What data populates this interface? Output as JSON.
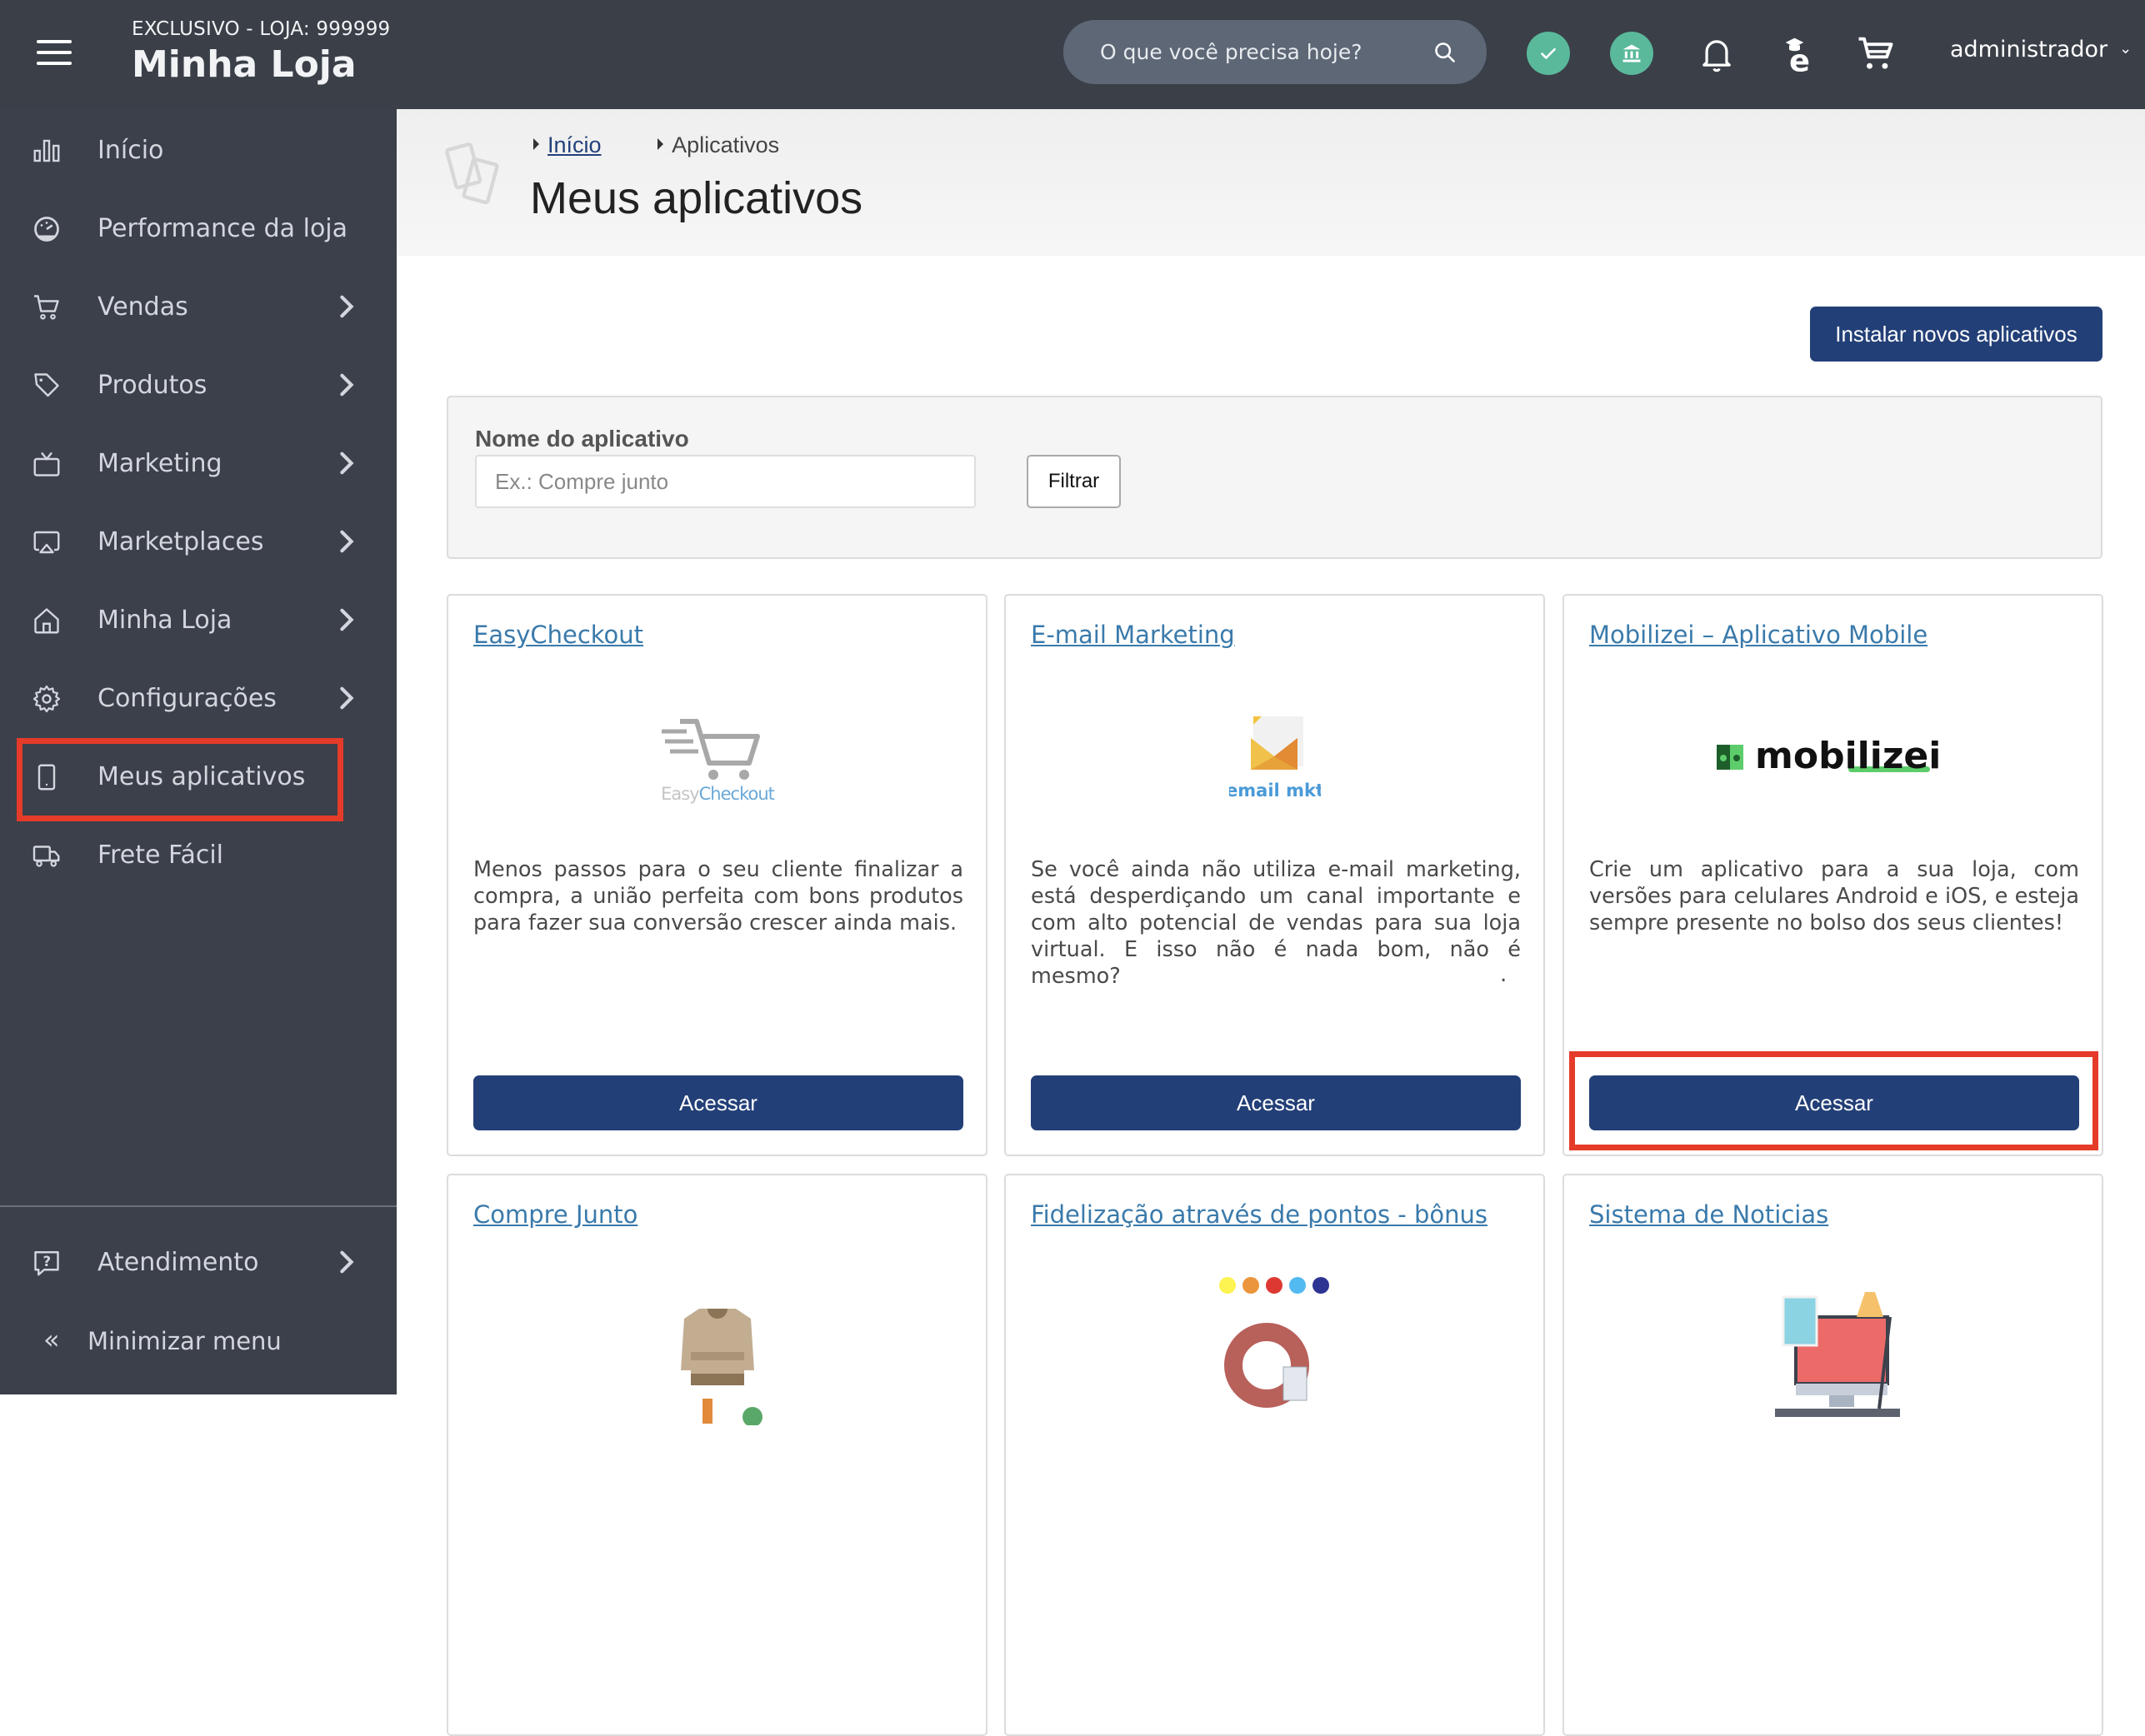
{
  "header": {
    "store_subtitle": "EXCLUSIVO - LOJA: 999999",
    "store_name": "Minha Loja",
    "search_placeholder": "O que você precisa hoje?",
    "icons": [
      "status-check-icon",
      "bank-icon",
      "bell-icon",
      "education-icon",
      "cart-icon"
    ],
    "user_label": "administrador",
    "accent_color": "#5ab99b"
  },
  "sidebar": {
    "items": [
      {
        "label": "Início",
        "icon": "bar-chart-icon",
        "has_submenu": false
      },
      {
        "label": "Performance da loja",
        "icon": "gauge-icon",
        "has_submenu": false
      },
      {
        "label": "Vendas",
        "icon": "cart-icon",
        "has_submenu": true
      },
      {
        "label": "Produtos",
        "icon": "tag-icon",
        "has_submenu": true
      },
      {
        "label": "Marketing",
        "icon": "tv-icon",
        "has_submenu": true
      },
      {
        "label": "Marketplaces",
        "icon": "airplay-icon",
        "has_submenu": true
      },
      {
        "label": "Minha Loja",
        "icon": "home-icon",
        "has_submenu": true
      },
      {
        "label": "Configurações",
        "icon": "gear-icon",
        "has_submenu": true
      },
      {
        "label": "Meus aplicativos",
        "icon": "phone-icon",
        "has_submenu": false,
        "highlighted": true
      },
      {
        "label": "Frete Fácil",
        "icon": "truck-icon",
        "has_submenu": false
      }
    ],
    "support": {
      "label": "Atendimento",
      "icon": "help-chat-icon",
      "has_submenu": true
    },
    "minimize_label": "Minimizar menu",
    "minimize_icon": "«"
  },
  "page": {
    "breadcrumb": [
      {
        "label": "Início",
        "link": true
      },
      {
        "label": "Aplicativos",
        "link": false
      }
    ],
    "title": "Meus aplicativos",
    "install_button": "Instalar novos aplicativos"
  },
  "filter": {
    "label": "Nome do aplicativo",
    "placeholder": "Ex.: Compre junto",
    "value": "",
    "button": "Filtrar"
  },
  "apps": [
    {
      "title": "EasyCheckout",
      "logo_text": "EasyCheckout",
      "description": "Menos passos para o seu cliente finalizar a compra, a união perfeita com bons produtos para fazer sua conversão crescer ainda mais.",
      "button": "Acessar"
    },
    {
      "title": "E-mail Marketing",
      "logo_text": "email mkt",
      "description": "Se você ainda não utiliza e-mail marketing, está desperdiçando um canal importante e com alto potencial de vendas para sua loja virtual. E isso não é nada bom, não é mesmo?",
      "extra": ".",
      "button": "Acessar"
    },
    {
      "title": "Mobilizei – Aplicativo Mobile",
      "logo_text": "mobilizei",
      "description": "Crie um aplicativo para a sua loja, com versões para celulares Android e iOS, e esteja sempre presente no bolso dos seus clientes!",
      "button": "Acessar",
      "highlighted": true
    },
    {
      "title": "Compre Junto",
      "logo_text": "",
      "description": "",
      "button": ""
    },
    {
      "title": "Fidelização através de pontos - bônus",
      "logo_text": "",
      "description": "",
      "button": ""
    },
    {
      "title": "Sistema de Noticias",
      "logo_text": "",
      "description": "",
      "button": ""
    }
  ],
  "colors": {
    "topbar": "#3a3f48",
    "sidebar": "#3b404a",
    "primary_button": "#233f77",
    "link": "#3a7aab",
    "highlight": "#e53b29"
  }
}
